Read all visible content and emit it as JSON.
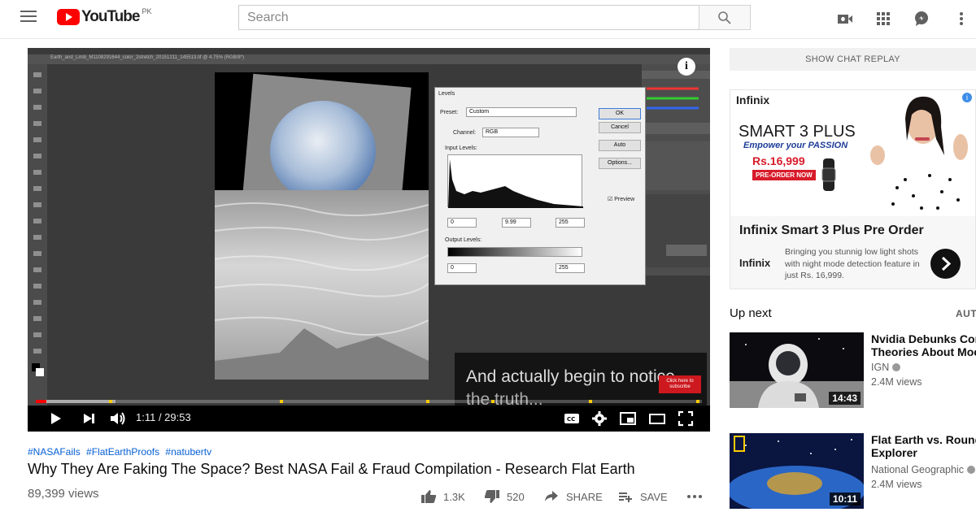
{
  "header": {
    "logo_text": "YouTube",
    "logo_country": "PK",
    "search_placeholder": "Search"
  },
  "player": {
    "photoshop_tab": "Earth_and_Limb_M1108291644_color_2stretch_20151211_145513.tif @ 4.75% (RGB/8*)",
    "dialog": {
      "title": "Levels",
      "preset_label": "Preset:",
      "preset_value": "Custom",
      "channel_label": "Channel:",
      "channel_value": "RGB",
      "input_levels_label": "Input Levels:",
      "input_values": [
        "0",
        "9.99",
        "255"
      ],
      "output_levels_label": "Output Levels:",
      "output_values": [
        "0",
        "255"
      ],
      "buttons": [
        "OK",
        "Cancel",
        "Auto",
        "Options..."
      ],
      "preview_label": "Preview"
    },
    "caption_lines": [
      "And actually begin to notice",
      "the truth..."
    ],
    "subscribe_badge": "Click here to subscribe",
    "time": "1:11 / 29:53",
    "progress_fraction": 0.016,
    "loaded_fraction": 0.12
  },
  "video": {
    "hashtags": [
      "#NASAFails",
      "#FlatEarthProofs",
      "#natubertv"
    ],
    "title": "Why They Are Faking The Space? Best NASA Fail & Fraud Compilation - Research Flat Earth",
    "views": "89,399 views",
    "likes": "1.3K",
    "dislikes": "520",
    "share_label": "SHARE",
    "save_label": "SAVE"
  },
  "sidebar": {
    "chat_replay": "SHOW CHAT REPLAY",
    "ad": {
      "brand": "Infinix",
      "headline": "SMART 3 PLUS",
      "tagline": "Empower your PASSION",
      "price": "Rs.16,999",
      "preorder": "PRE-ORDER NOW",
      "title": "Infinix Smart 3 Plus Pre Order",
      "logo": "Infinix",
      "description": "Bringing you stunnig low light shots with night mode detection feature in just Rs. 16,999."
    },
    "up_next": "Up next",
    "autoplay": "AUT",
    "videos": [
      {
        "title_line1": "Nvidia Debunks Cons",
        "title_line2": "Theories About Moon",
        "channel": "IGN",
        "views": "2.4M views",
        "duration": "14:43"
      },
      {
        "title_line1": "Flat Earth vs. Round E",
        "title_line2": "Explorer",
        "channel": "National Geographic",
        "views": "2.4M views",
        "duration": "10:11"
      }
    ]
  },
  "colors": {
    "brand_red": "#ff0000",
    "link_blue": "#065fd4",
    "text_gray": "#606060"
  }
}
